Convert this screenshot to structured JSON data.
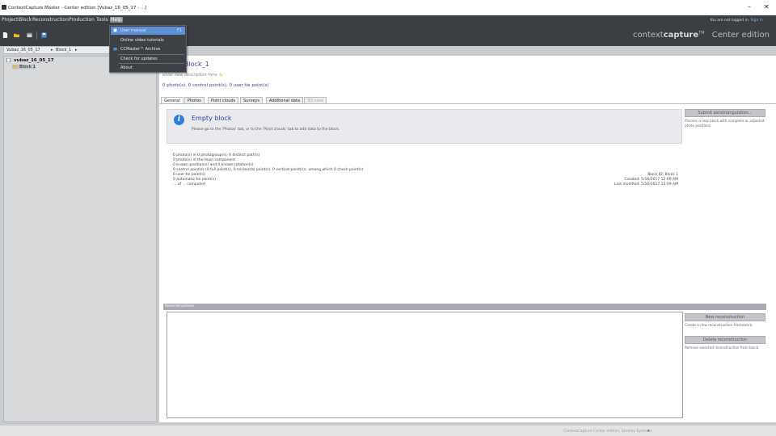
{
  "window": {
    "title": "ContextCapture Master - Center edition [Vubaz_16_05_17 - ...]",
    "minimize_glyph": "–",
    "close_glyph": "✕"
  },
  "menu": {
    "items": [
      "Project",
      "Block",
      "Reconstruction",
      "Production",
      "Tools",
      "Help"
    ],
    "license_text": "You are not logged in.",
    "license_link": "Sign In"
  },
  "brand": {
    "normal": "context",
    "bold": "capture",
    "tm": "TM",
    "edition": "Center edition"
  },
  "breadcrumb": {
    "project": "Vubaz_16_05_17",
    "sep": "▸",
    "block": "Block_1",
    "arrow": "▸"
  },
  "tree": {
    "project": "vubaz_16_05_17",
    "block": "Block 1"
  },
  "main": {
    "block_title": "Block_1",
    "description": "enter new description here",
    "summary": "0 photo(s), 0 control point(s), 0 user tie point(s)",
    "tabs": [
      "General",
      "Photos",
      "Point clouds",
      "Surveys",
      "Additional data",
      "3D view"
    ],
    "info_title": "Empty block",
    "info_message": "Please go to the 'Photos' tab, or to the 'Point clouds' tab to add data to the block.",
    "stats": [
      "0 photo(s) in 0 photogroup(s), 0 distinct path(s)",
      "0 photo(s) in the main component",
      "0 known position(s) and 0 known rotation(s)",
      "0 control point(s) (0 full point(s), 0 horizontal point(s), 0 vertical point(s)), among which 0 check point(s)",
      "0 user tie point(s)",
      "0 automatic tie point(s)",
      "... of ... computed"
    ],
    "meta": [
      "Block ID: Block 1",
      "Created: 5/16/2017 12:09 AM",
      "Last modified: 5/16/2017 12:09 AM"
    ]
  },
  "side": {
    "submit_aero": "Submit aerotriangulation...",
    "submit_note": "Process a new block with complete or adjusted photo positions.",
    "new_recon": "New reconstruction",
    "new_note": "Create a new reconstruction framework.",
    "delete_recon": "Delete reconstruction",
    "delete_note": "Remove selected reconstruction from block."
  },
  "recon": {
    "header": "Reconstructions"
  },
  "status": {
    "text": "ContextCapture Center edition, Bentley Systems",
    "arrow": "▾"
  },
  "help_menu": {
    "items": [
      {
        "label": "User manual",
        "key": "F1"
      },
      {
        "label": "Online video tutorials",
        "key": ""
      },
      {
        "label": "CCMaster™ Archive",
        "key": ""
      },
      {
        "label": "Check for updates",
        "key": ""
      },
      {
        "label": "About",
        "key": ""
      }
    ]
  },
  "colors": {
    "accent": "#5b8fd6",
    "menubar": "#3b3f44",
    "link": "#3a3ab3",
    "info": "#2a7de1"
  }
}
